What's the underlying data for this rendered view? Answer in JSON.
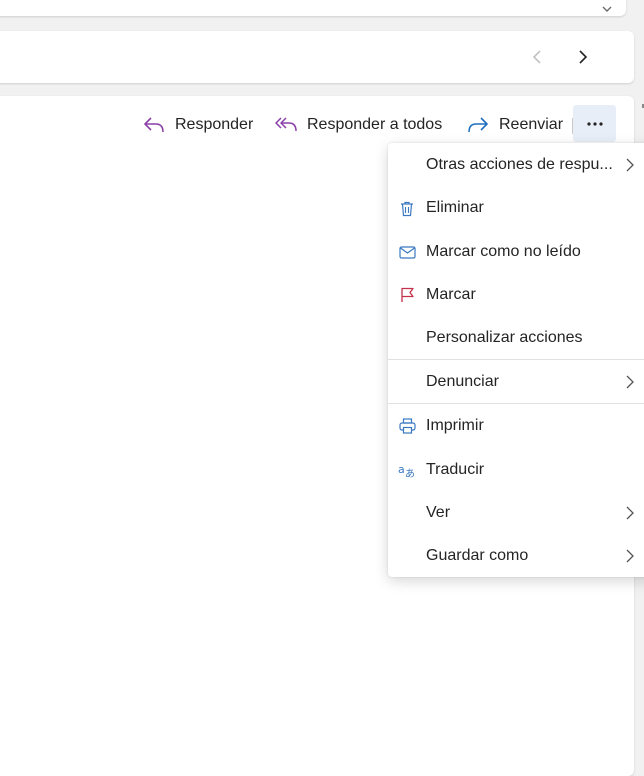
{
  "navigation": {
    "prev_label": "",
    "next_label": ""
  },
  "toolbar": {
    "reply_label": "Responder",
    "reply_all_label": "Responder a todos",
    "forward_label": "Reenviar"
  },
  "menu": {
    "items": [
      {
        "label": "Otras acciones de respu...",
        "icon": "none",
        "submenu": true
      },
      {
        "label": "Eliminar",
        "icon": "trash-icon",
        "submenu": false
      },
      {
        "label": "Marcar como no leído",
        "icon": "envelope-icon",
        "submenu": false
      },
      {
        "label": "Marcar",
        "icon": "flag-icon",
        "submenu": false
      },
      {
        "label": "Personalizar acciones",
        "icon": "none",
        "submenu": false
      },
      {
        "label": "Denunciar",
        "icon": "none",
        "submenu": true
      },
      {
        "label": "Imprimir",
        "icon": "printer-icon",
        "submenu": false
      },
      {
        "label": "Traducir",
        "icon": "translate-icon",
        "submenu": false
      },
      {
        "label": "Ver",
        "icon": "none",
        "submenu": true
      },
      {
        "label": "Guardar como",
        "icon": "none",
        "submenu": true
      }
    ]
  },
  "colors": {
    "reply_accent": "#8b3fa8",
    "forward_accent": "#1f6fbf",
    "icon_blue": "#3a78c2",
    "flag_red": "#c4314b",
    "more_button_bg": "#e8eef8"
  }
}
